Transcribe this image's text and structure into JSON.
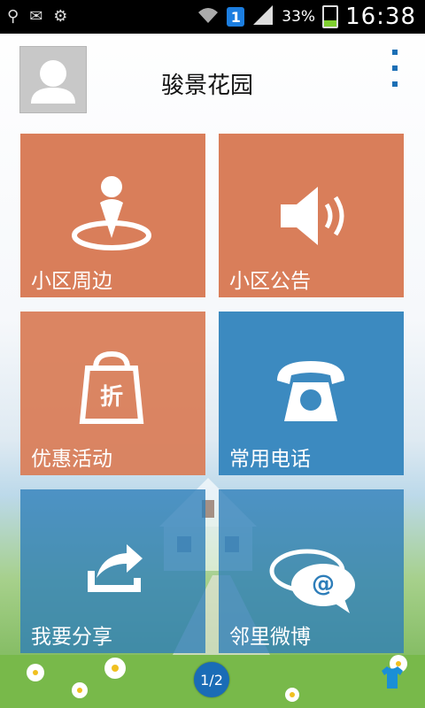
{
  "status_bar": {
    "icons": [
      "usb-icon",
      "mail-icon",
      "notification-icon",
      "wifi-icon",
      "signal-icon"
    ],
    "badge": "1",
    "battery_percent": "33%",
    "battery_level": 0.33,
    "time": "16:38"
  },
  "header": {
    "title": "骏景花园"
  },
  "tiles": [
    {
      "label": "小区周边",
      "icon": "map-pin-icon",
      "color": "#d97e5a"
    },
    {
      "label": "小区公告",
      "icon": "speaker-icon",
      "color": "#d97e5a"
    },
    {
      "label": "优惠活动",
      "icon": "shopping-bag-icon",
      "color": "#d97e5a",
      "icon_text": "折"
    },
    {
      "label": "常用电话",
      "icon": "telephone-icon",
      "color": "#3c8ac0"
    },
    {
      "label": "我要分享",
      "icon": "share-icon",
      "color": "#3c8ac0"
    },
    {
      "label": "邻里微博",
      "icon": "chat-bubbles-icon",
      "color": "#3c8ac0",
      "icon_text": "@"
    }
  ],
  "pager": {
    "text": "1/2"
  },
  "colors": {
    "accent_blue": "#1a6cb6",
    "tile_orange": "#d97e5a",
    "tile_blue": "#3c8ac0"
  }
}
